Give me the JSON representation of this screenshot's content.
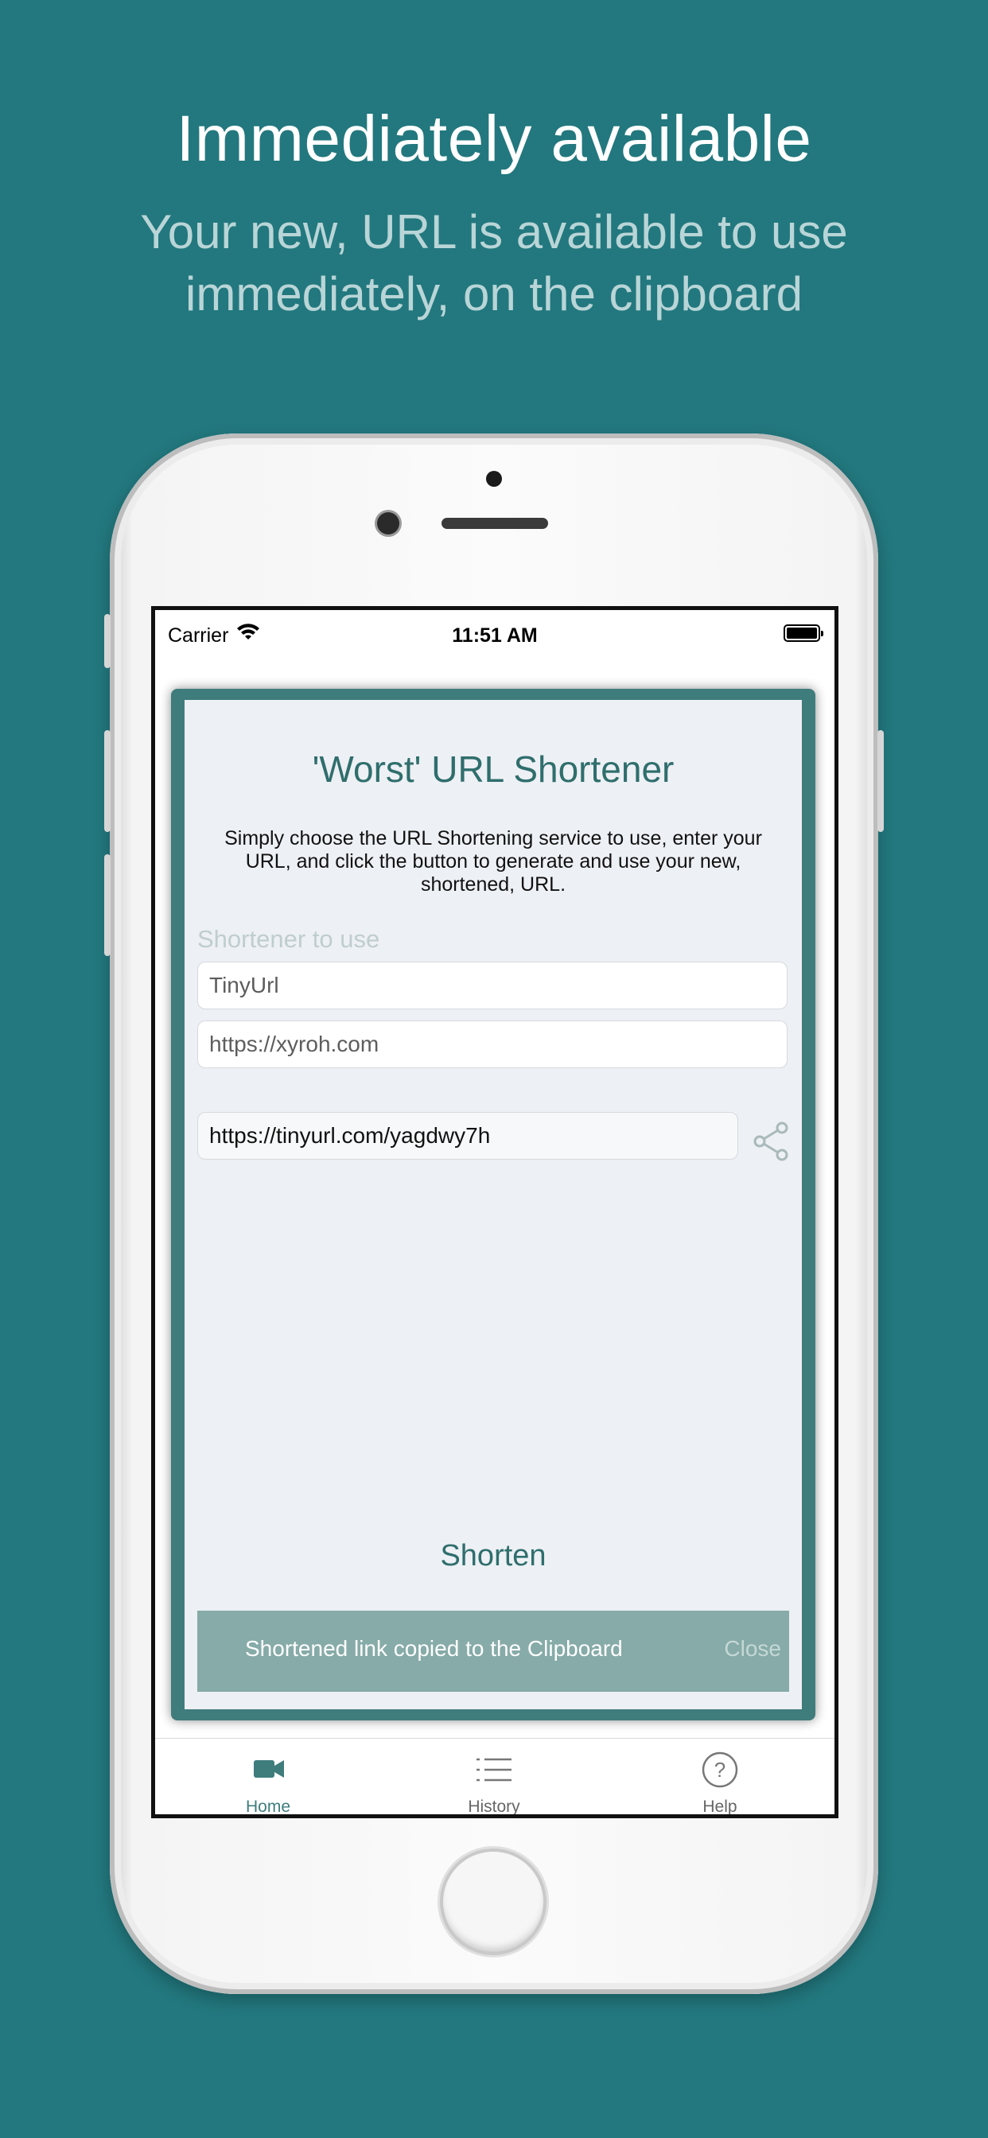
{
  "promo": {
    "headline": "Immediately available",
    "subline": "Your new, URL is available to use immediately, on the clipboard"
  },
  "status_bar": {
    "carrier": "Carrier",
    "time": "11:51 AM"
  },
  "app": {
    "title": "'Worst' URL Shortener",
    "description": "Simply choose the URL Shortening service to use, enter your URL, and click the button to generate and use your new, shortened, URL.",
    "shortener_label": "Shortener to use",
    "shortener_value": "TinyUrl",
    "url_value": "https://xyroh.com",
    "result_value": "https://tinyurl.com/yagdwy7h",
    "shorten_label": "Shorten"
  },
  "toast": {
    "message": "Shortened link copied to the Clipboard",
    "close_label": "Close"
  },
  "tabs": [
    {
      "label": "Home",
      "icon": "video-camera-icon",
      "active": true
    },
    {
      "label": "History",
      "icon": "list-icon",
      "active": false
    },
    {
      "label": "Help",
      "icon": "question-circle-icon",
      "active": false
    }
  ],
  "colors": {
    "background": "#22787e",
    "accent": "#3f7c7c",
    "toast": "#86aba8"
  }
}
